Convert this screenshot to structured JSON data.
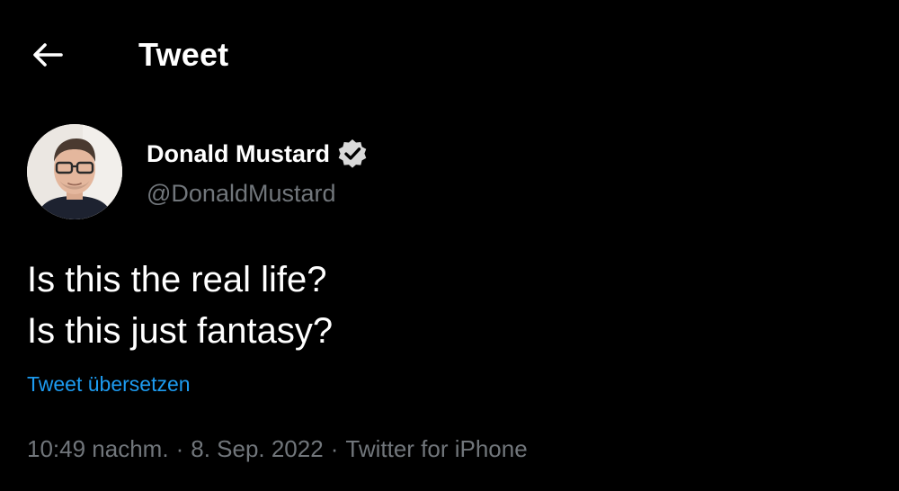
{
  "header": {
    "back_icon": "arrow-left-icon",
    "title": "Tweet"
  },
  "author": {
    "display_name": "Donald Mustard",
    "verified_icon": "verified-badge-icon",
    "handle": "@DonaldMustard"
  },
  "tweet": {
    "lines": [
      "Is this the real life?",
      "Is this just fantasy?"
    ],
    "translate_label": "Tweet übersetzen",
    "time": "10:49 nachm.",
    "separator": "·",
    "date": "8. Sep. 2022",
    "source": "Twitter for iPhone"
  },
  "colors": {
    "background": "#000000",
    "primary_text": "#ffffff",
    "secondary_text": "#71767b",
    "link": "#1d9bf0"
  }
}
